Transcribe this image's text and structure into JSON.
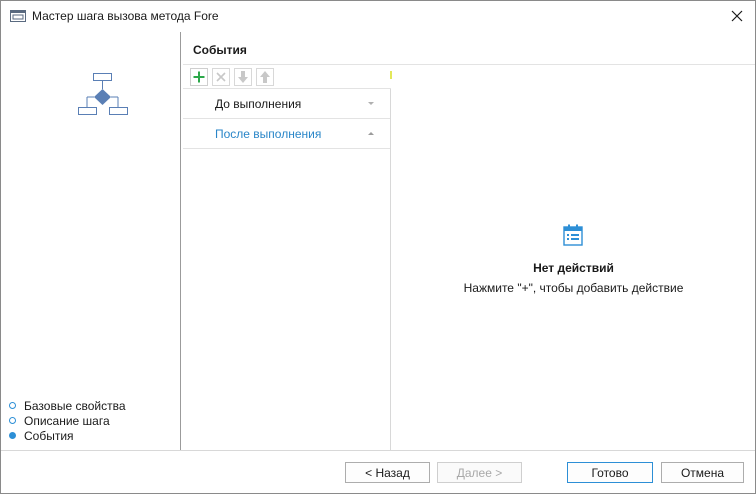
{
  "window": {
    "title": "Мастер шага вызова метода Fore"
  },
  "wizard": {
    "steps": [
      {
        "label": "Базовые свойства",
        "state": "visited"
      },
      {
        "label": "Описание шага",
        "state": "visited"
      },
      {
        "label": "События",
        "state": "current"
      }
    ]
  },
  "section": {
    "title": "События"
  },
  "toolbar": {
    "buttons": [
      {
        "icon": "plus-icon",
        "enabled": true
      },
      {
        "icon": "delete-icon",
        "enabled": false
      },
      {
        "icon": "move-down-icon",
        "enabled": false
      },
      {
        "icon": "move-up-icon",
        "enabled": false
      }
    ]
  },
  "events": {
    "items": [
      {
        "label": "До выполнения",
        "expanded": false
      },
      {
        "label": "После выполнения",
        "expanded": true
      }
    ]
  },
  "empty_state": {
    "icon": "calendar-list-icon",
    "title": "Нет действий",
    "hint": "Нажмите \"+\", чтобы добавить действие"
  },
  "footer": {
    "back_label": "< Назад",
    "next_label": "Далее >",
    "ok_label": "Готово",
    "cancel_label": "Отмена"
  },
  "colors": {
    "accent": "#2d8fd6",
    "selected_text": "#2a86c8",
    "add_green": "#2ca84a",
    "diagram_blue": "#5a7fb5"
  }
}
